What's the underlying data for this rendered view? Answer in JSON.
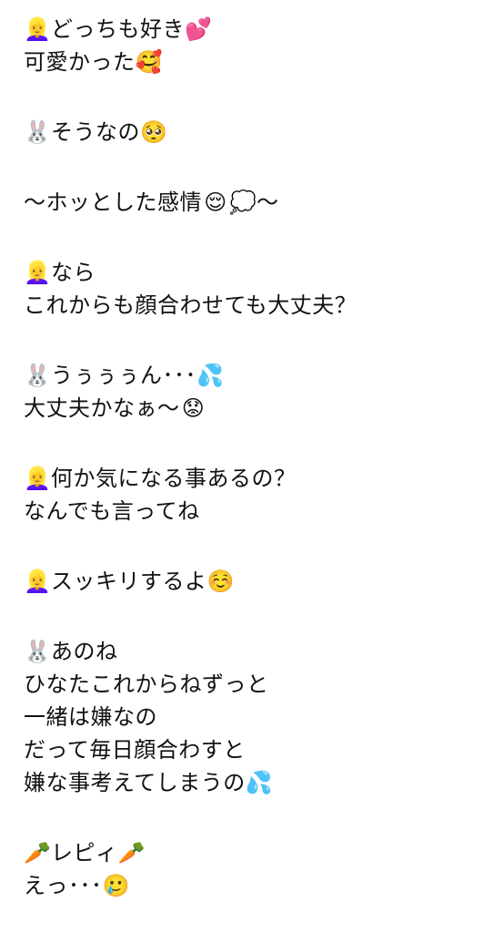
{
  "blocks": [
    [
      {
        "icon": "person-icon",
        "glyph": "👱‍♀️",
        "text": "どっちも好き",
        "trail_icon": "hearts-icon",
        "trail_glyph": "💕"
      },
      {
        "text": "可愛かった",
        "trail_icon": "smiling-hearts-icon",
        "trail_glyph": "🥰"
      }
    ],
    [
      {
        "icon": "rabbit-icon",
        "glyph": "🐰",
        "text": "そうなの",
        "trail_icon": "pleading-face-icon",
        "trail_glyph": "🥺"
      }
    ],
    [
      {
        "text": "〜ホッとした感情",
        "trail_icon": "relieved-face-icon",
        "trail_glyph": "😌",
        "trail_icon2": "thought-balloon-icon",
        "trail_glyph2": "💭",
        "tail": "〜"
      }
    ],
    [
      {
        "icon": "person-icon",
        "glyph": "👱‍♀️",
        "text": "なら"
      },
      {
        "text": "これからも顔合わせても大丈夫？"
      }
    ],
    [
      {
        "icon": "rabbit-icon",
        "glyph": "🐰",
        "text": "うぅぅぅん･･･",
        "trail_icon": "sweat-droplets-icon",
        "trail_glyph": "💦"
      },
      {
        "text": "大丈夫かなぁ〜",
        "trail_icon": "worried-face-icon",
        "trail_glyph": "😟"
      }
    ],
    [
      {
        "icon": "person-icon",
        "glyph": "👱‍♀️",
        "text": "何か気になる事あるの？"
      },
      {
        "text": "なんでも言ってね"
      }
    ],
    [
      {
        "icon": "person-icon",
        "glyph": "👱‍♀️",
        "text": "スッキリするよ",
        "trail_icon": "smiling-face-icon",
        "trail_glyph": "☺️"
      }
    ],
    [
      {
        "icon": "rabbit-icon",
        "glyph": "🐰",
        "text": "あのね"
      },
      {
        "text": "ひなたこれからねずっと"
      },
      {
        "text": "一緒は嫌なの"
      },
      {
        "text": "だって毎日顔合わすと"
      },
      {
        "text": "嫌な事考えてしまうの",
        "trail_icon": "sweat-droplets-icon",
        "trail_glyph": "💦"
      }
    ],
    [
      {
        "icon": "carrot-icon",
        "glyph": "🥕",
        "text": "レピィ",
        "trail_icon": "carrot-icon",
        "trail_glyph": "🥕"
      },
      {
        "text": "えっ･･･",
        "trail_icon": "face-holding-back-tears-icon",
        "trail_glyph": "🥲"
      }
    ]
  ]
}
